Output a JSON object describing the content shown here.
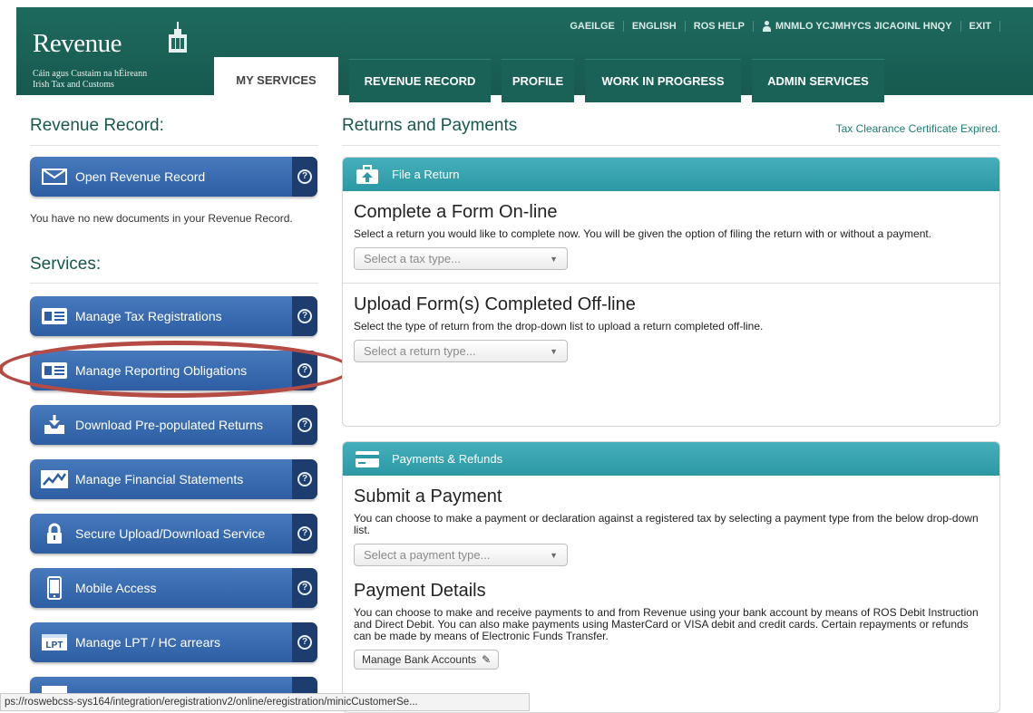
{
  "header": {
    "logo_word": "Revenue",
    "logo_sub1": "Cáin agus Custaim na hÉireann",
    "logo_sub2": "Irish Tax and Customs",
    "links": {
      "gaeilge": "GAEILGE",
      "english": "ENGLISH",
      "ros_help": "ROS HELP",
      "user": "MNMLO YCJMHYCS JICAOINL HNQY",
      "exit": "EXIT"
    },
    "tabs": [
      {
        "label": "MY SERVICES",
        "active": true
      },
      {
        "label": "REVENUE RECORD",
        "active": false
      },
      {
        "label": "PROFILE",
        "active": false
      },
      {
        "label": "WORK IN PROGRESS",
        "active": false
      },
      {
        "label": "ADMIN SERVICES",
        "active": false
      }
    ]
  },
  "left": {
    "revenue_record_title": "Revenue Record:",
    "open_record_label": "Open Revenue Record",
    "no_docs_text": "You have no new documents in your Revenue Record.",
    "services_title": "Services:",
    "services": [
      {
        "label": "Manage Tax Registrations",
        "icon": "id-card-icon"
      },
      {
        "label": "Manage Reporting Obligations",
        "icon": "id-card-icon"
      },
      {
        "label": "Download Pre-populated Returns",
        "icon": "download-tray-icon"
      },
      {
        "label": "Manage Financial Statements",
        "icon": "line-chart-icon"
      },
      {
        "label": "Secure Upload/Download Service",
        "icon": "padlock-icon"
      },
      {
        "label": "Mobile Access",
        "icon": "mobile-phone-icon"
      },
      {
        "label": "Manage LPT / HC arrears",
        "icon": "lpt-icon"
      }
    ],
    "help_glyph": "?",
    "lpt_text": "LPT"
  },
  "right": {
    "title": "Returns and Payments",
    "tcc_status": "Tax Clearance Certificate Expired.",
    "file_return": {
      "header": "File a Return",
      "online_title": "Complete a Form On-line",
      "online_text": "Select a return you would like to complete now. You will be given the option of filing the return with or without a payment.",
      "online_select": "Select a tax type...",
      "offline_title": "Upload Form(s) Completed Off-line",
      "offline_text": "Select the type of return from the drop-down list to upload a return completed off-line.",
      "offline_select": "Select a return type..."
    },
    "payments": {
      "header": "Payments & Refunds",
      "submit_title": "Submit a Payment",
      "submit_text": "You can choose to make a payment or declaration against a registered tax by selecting a payment type from the below drop-down list.",
      "submit_select": "Select a payment type...",
      "details_title": "Payment Details",
      "details_text": "You can choose to make and receive payments to and from Revenue using your bank account by means of ROS Debit Instruction and Direct Debit. You can also make payments using MasterCard or VISA debit and credit cards. Certain repayments or refunds can be made by means of Electronic Funds Transfer.",
      "manage_bank": "Manage Bank Accounts"
    }
  },
  "statusbar": {
    "url": "ps://roswebcss-sys164/integration/eregistrationv2/online/eregistration/minicCustomerSe..."
  },
  "colors": {
    "header_green": "#1e6a5e",
    "button_blue": "#3a6cb0",
    "panel_teal": "#36a2ae",
    "title_green": "#18574d",
    "highlight_red": "#b44c45"
  }
}
